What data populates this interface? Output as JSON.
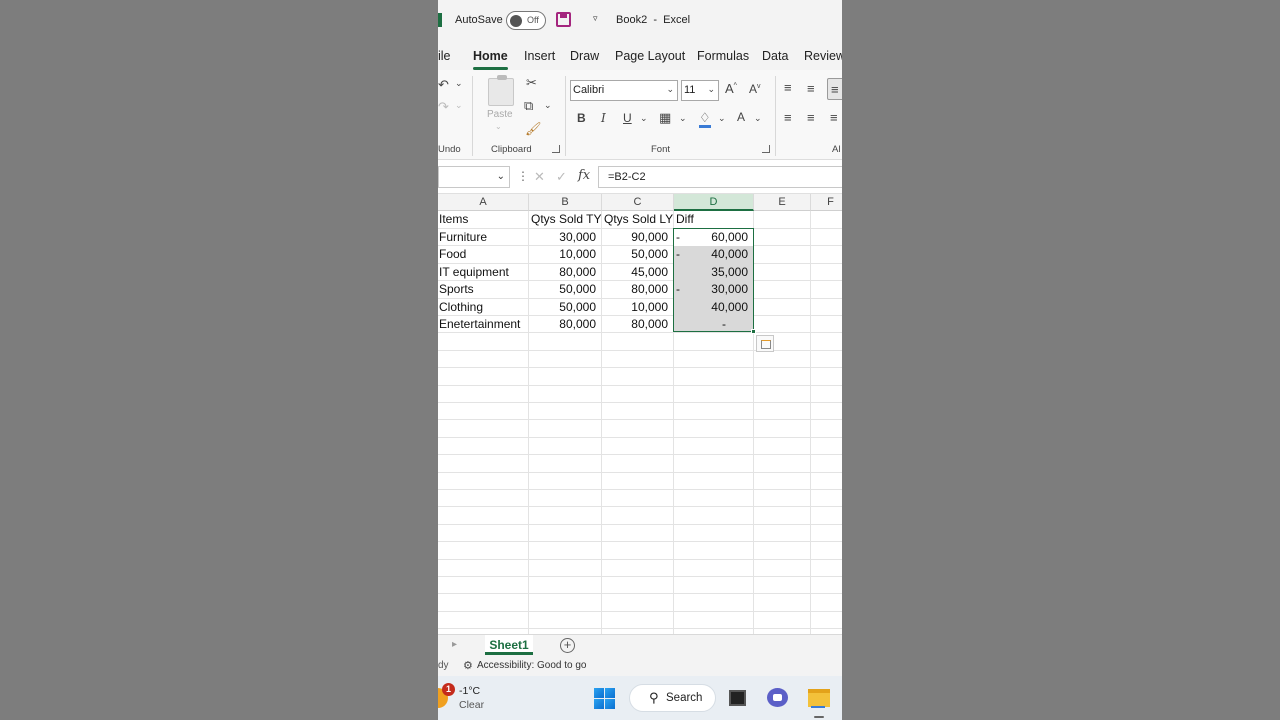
{
  "titlebar": {
    "autosave_label": "AutoSave",
    "autosave_state": "Off",
    "title": "Book2",
    "separator": "-",
    "app": "Excel"
  },
  "tabs": [
    "ile",
    "Home",
    "Insert",
    "Draw",
    "Page Layout",
    "Formulas",
    "Data",
    "Review"
  ],
  "active_tab": "Home",
  "ribbon": {
    "undo_label": "Undo",
    "paste_label": "Paste",
    "clipboard_label": "Clipboard",
    "font_name": "Calibri",
    "font_size": "11",
    "font_label": "Font",
    "align_label": "Al",
    "bold": "B",
    "italic": "I",
    "underline": "U",
    "font_color_letter": "A",
    "grow_font": "A",
    "shrink_font": "A"
  },
  "formula_bar": {
    "fx": "fx",
    "formula": "=B2-C2"
  },
  "sheet": {
    "columns": [
      "A",
      "B",
      "C",
      "D",
      "E",
      "F"
    ],
    "headers": [
      "Items",
      "Qtys Sold TY",
      "Qtys Sold LY",
      "Diff"
    ],
    "rows": [
      {
        "item": "Furniture",
        "ty": "30,000",
        "ly": "90,000",
        "sign": "-",
        "diff": "60,000"
      },
      {
        "item": "Food",
        "ty": "10,000",
        "ly": "50,000",
        "sign": "-",
        "diff": "40,000"
      },
      {
        "item": "IT equipment",
        "ty": "80,000",
        "ly": "45,000",
        "sign": "",
        "diff": "35,000"
      },
      {
        "item": "Sports",
        "ty": "50,000",
        "ly": "80,000",
        "sign": "-",
        "diff": "30,000"
      },
      {
        "item": "Clothing",
        "ty": "50,000",
        "ly": "10,000",
        "sign": "",
        "diff": "40,000"
      },
      {
        "item": "Enetertainment",
        "ty": "80,000",
        "ly": "80,000",
        "sign": "",
        "diff": "-"
      }
    ],
    "selected_column": "D"
  },
  "sheet_tabs": {
    "active": "Sheet1",
    "add": "+"
  },
  "status": {
    "ready": "dy",
    "accessibility": "Accessibility: Good to go"
  },
  "taskbar": {
    "badge": "1",
    "temperature": "-1°C",
    "condition": "Clear",
    "search": "Search"
  }
}
